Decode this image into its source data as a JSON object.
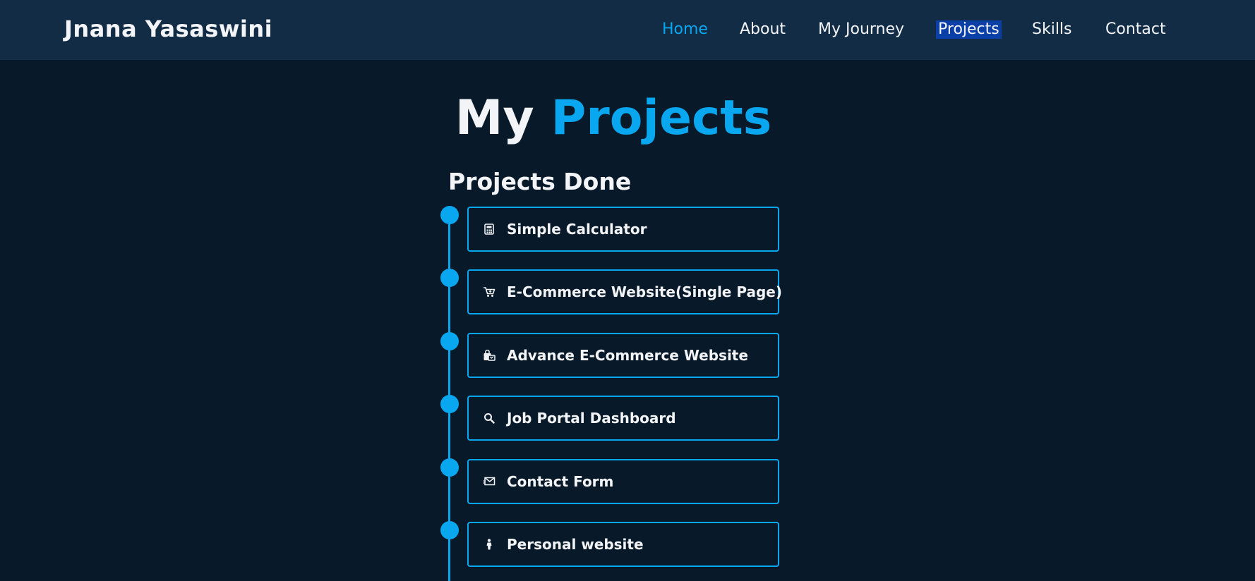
{
  "header": {
    "brand": "Jnana Yasaswini",
    "nav": [
      {
        "label": "Home",
        "state": "active"
      },
      {
        "label": "About"
      },
      {
        "label": "My Journey"
      },
      {
        "label": "Projects",
        "state": "selected"
      },
      {
        "label": "Skills"
      },
      {
        "label": "Contact"
      }
    ]
  },
  "main": {
    "title_part1": "My",
    "title_part2": "Projects",
    "section_title": "Projects Done",
    "projects": [
      {
        "label": "Simple Calculator",
        "icon": "calculator-icon"
      },
      {
        "label": "E-Commerce Website(Single Page)",
        "icon": "cart-icon"
      },
      {
        "label": "Advance E-Commerce Website",
        "icon": "shopping-bags-icon"
      },
      {
        "label": "Job Portal Dashboard",
        "icon": "search-icon"
      },
      {
        "label": "Contact Form",
        "icon": "envelope-icon"
      },
      {
        "label": "Personal website",
        "icon": "person-icon"
      }
    ]
  },
  "colors": {
    "accent": "#09a7f0",
    "background": "#081a29",
    "navbar": "#122c45",
    "selection": "#0a3fa8"
  }
}
